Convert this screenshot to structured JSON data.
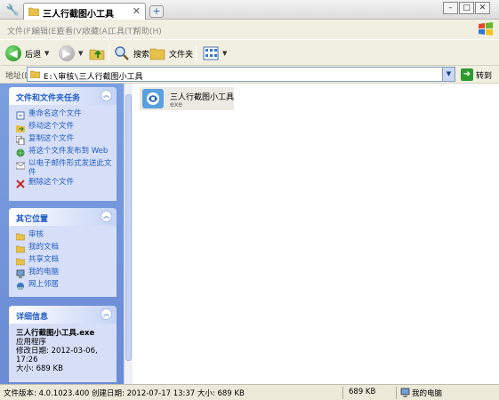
{
  "tab": {
    "title": "三人行截图小工具",
    "close": "✕",
    "new_tab": "+"
  },
  "window_controls": {
    "minimize": "–",
    "maximize": "□",
    "close": "✕"
  },
  "menu": [
    "文件(F)",
    "编辑(E)",
    "查看(V)",
    "收藏(A)",
    "工具(T)",
    "帮助(H)"
  ],
  "toolbar": {
    "back": "后退",
    "search": "搜索",
    "folders": "文件夹"
  },
  "address": {
    "label": "地址(D)",
    "path": "E:\\审核\\三人行截图小工具",
    "go": "转到"
  },
  "task_panels": {
    "file_tasks": {
      "title": "文件和文件夹任务",
      "items": [
        "重命名这个文件",
        "移动这个文件",
        "复制这个文件",
        "将这个文件发布到 Web",
        "以电子邮件形式发送此文件",
        "删除这个文件"
      ]
    },
    "other_places": {
      "title": "其它位置",
      "items": [
        "审核",
        "我的文档",
        "共享文档",
        "我的电脑",
        "网上邻居"
      ]
    },
    "details": {
      "title": "详细信息",
      "filename": "三人行截图小工具.exe",
      "type": "应用程序",
      "modified_label": "修改日期:",
      "modified": "2012-03-06, 17:26",
      "size_label": "大小:",
      "size": "689 KB"
    }
  },
  "file": {
    "name": "三人行截图小工具",
    "ext": "exe"
  },
  "status": {
    "info": "文件版本: 4.0.1023.400 创建日期: 2012-07-17 13:37 大小: 689 KB",
    "size": "689 KB",
    "location": "我的电脑"
  },
  "colors": {
    "task_pane": "#6b8bd6",
    "link": "#215dc6",
    "panel": "#d6dff7"
  }
}
